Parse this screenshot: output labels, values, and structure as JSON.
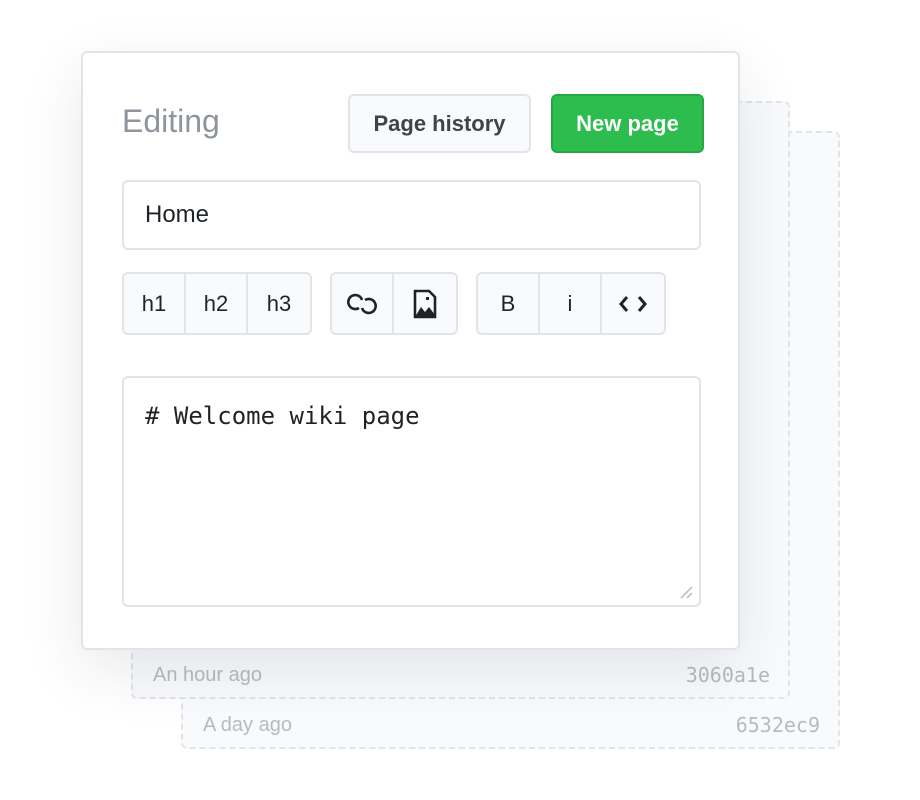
{
  "history": [
    {
      "when": "An hour ago",
      "sha": "3060a1e"
    },
    {
      "when": "A day ago",
      "sha": "6532ec9"
    }
  ],
  "editor": {
    "title": "Editing",
    "page_history_label": "Page history",
    "new_page_label": "New page",
    "page_name_value": "Home",
    "toolbar": {
      "h1": "h1",
      "h2": "h2",
      "h3": "h3",
      "bold": "B",
      "italic": "i"
    },
    "content": "# Welcome wiki page"
  },
  "colors": {
    "accent": "#2dbc4e",
    "border": "#e1e5ea",
    "muted": "#8f959c"
  }
}
